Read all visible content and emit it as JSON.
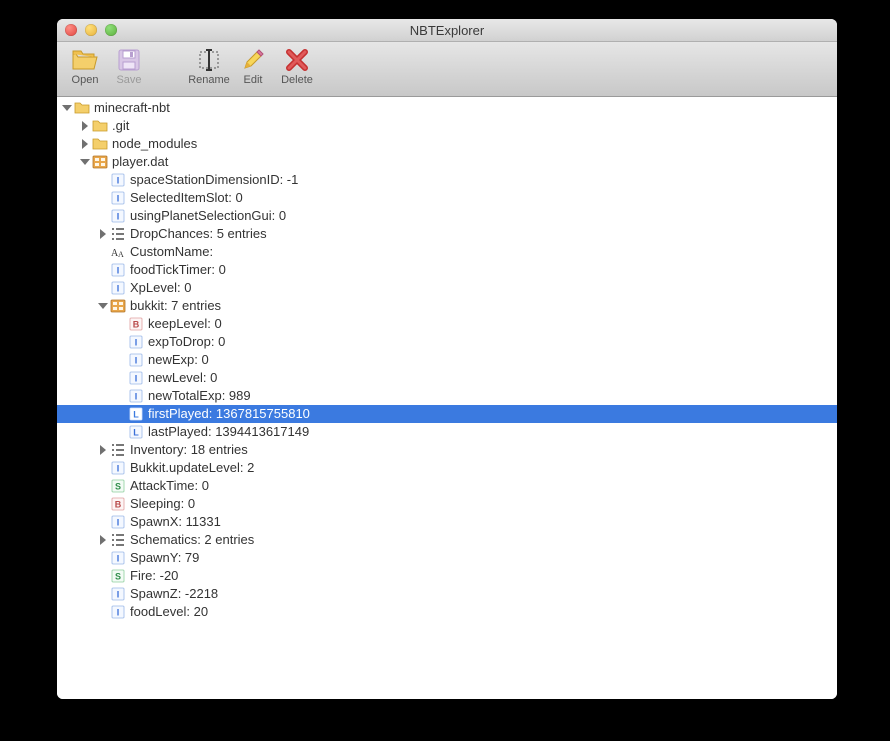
{
  "window": {
    "title": "NBTExplorer"
  },
  "toolbar": {
    "open": {
      "label": "Open",
      "enabled": true
    },
    "save": {
      "label": "Save",
      "enabled": false
    },
    "rename": {
      "label": "Rename",
      "enabled": true
    },
    "edit": {
      "label": "Edit",
      "enabled": true
    },
    "delete": {
      "label": "Delete",
      "enabled": true
    }
  },
  "tree": [
    {
      "depth": 0,
      "arrow": "down",
      "icon": "folder",
      "label": "minecraft-nbt"
    },
    {
      "depth": 1,
      "arrow": "right",
      "icon": "folder",
      "label": ".git"
    },
    {
      "depth": 1,
      "arrow": "right",
      "icon": "folder",
      "label": "node_modules"
    },
    {
      "depth": 1,
      "arrow": "down",
      "icon": "compound",
      "label": "player.dat"
    },
    {
      "depth": 2,
      "arrow": "none",
      "icon": "int",
      "label": "spaceStationDimensionID: -1"
    },
    {
      "depth": 2,
      "arrow": "none",
      "icon": "int",
      "label": "SelectedItemSlot: 0"
    },
    {
      "depth": 2,
      "arrow": "none",
      "icon": "int",
      "label": "usingPlanetSelectionGui: 0"
    },
    {
      "depth": 2,
      "arrow": "right",
      "icon": "list",
      "label": "DropChances: 5 entries"
    },
    {
      "depth": 2,
      "arrow": "none",
      "icon": "string",
      "label": "CustomName:"
    },
    {
      "depth": 2,
      "arrow": "none",
      "icon": "int",
      "label": "foodTickTimer: 0"
    },
    {
      "depth": 2,
      "arrow": "none",
      "icon": "int",
      "label": "XpLevel: 0"
    },
    {
      "depth": 2,
      "arrow": "down",
      "icon": "compound",
      "label": "bukkit: 7 entries"
    },
    {
      "depth": 3,
      "arrow": "none",
      "icon": "byte",
      "label": "keepLevel: 0"
    },
    {
      "depth": 3,
      "arrow": "none",
      "icon": "int",
      "label": "expToDrop: 0"
    },
    {
      "depth": 3,
      "arrow": "none",
      "icon": "int",
      "label": "newExp: 0"
    },
    {
      "depth": 3,
      "arrow": "none",
      "icon": "int",
      "label": "newLevel: 0"
    },
    {
      "depth": 3,
      "arrow": "none",
      "icon": "int",
      "label": "newTotalExp: 989"
    },
    {
      "depth": 3,
      "arrow": "none",
      "icon": "long",
      "label": "firstPlayed: 1367815755810",
      "selected": true
    },
    {
      "depth": 3,
      "arrow": "none",
      "icon": "long",
      "label": "lastPlayed: 1394413617149"
    },
    {
      "depth": 2,
      "arrow": "right",
      "icon": "list",
      "label": "Inventory: 18 entries"
    },
    {
      "depth": 2,
      "arrow": "none",
      "icon": "int",
      "label": "Bukkit.updateLevel: 2"
    },
    {
      "depth": 2,
      "arrow": "none",
      "icon": "short",
      "label": "AttackTime: 0"
    },
    {
      "depth": 2,
      "arrow": "none",
      "icon": "byte",
      "label": "Sleeping: 0"
    },
    {
      "depth": 2,
      "arrow": "none",
      "icon": "int",
      "label": "SpawnX: 11331"
    },
    {
      "depth": 2,
      "arrow": "right",
      "icon": "list",
      "label": "Schematics: 2 entries"
    },
    {
      "depth": 2,
      "arrow": "none",
      "icon": "int",
      "label": "SpawnY: 79"
    },
    {
      "depth": 2,
      "arrow": "none",
      "icon": "short",
      "label": "Fire: -20"
    },
    {
      "depth": 2,
      "arrow": "none",
      "icon": "int",
      "label": "SpawnZ: -2218"
    },
    {
      "depth": 2,
      "arrow": "none",
      "icon": "int",
      "label": "foodLevel: 20"
    }
  ]
}
